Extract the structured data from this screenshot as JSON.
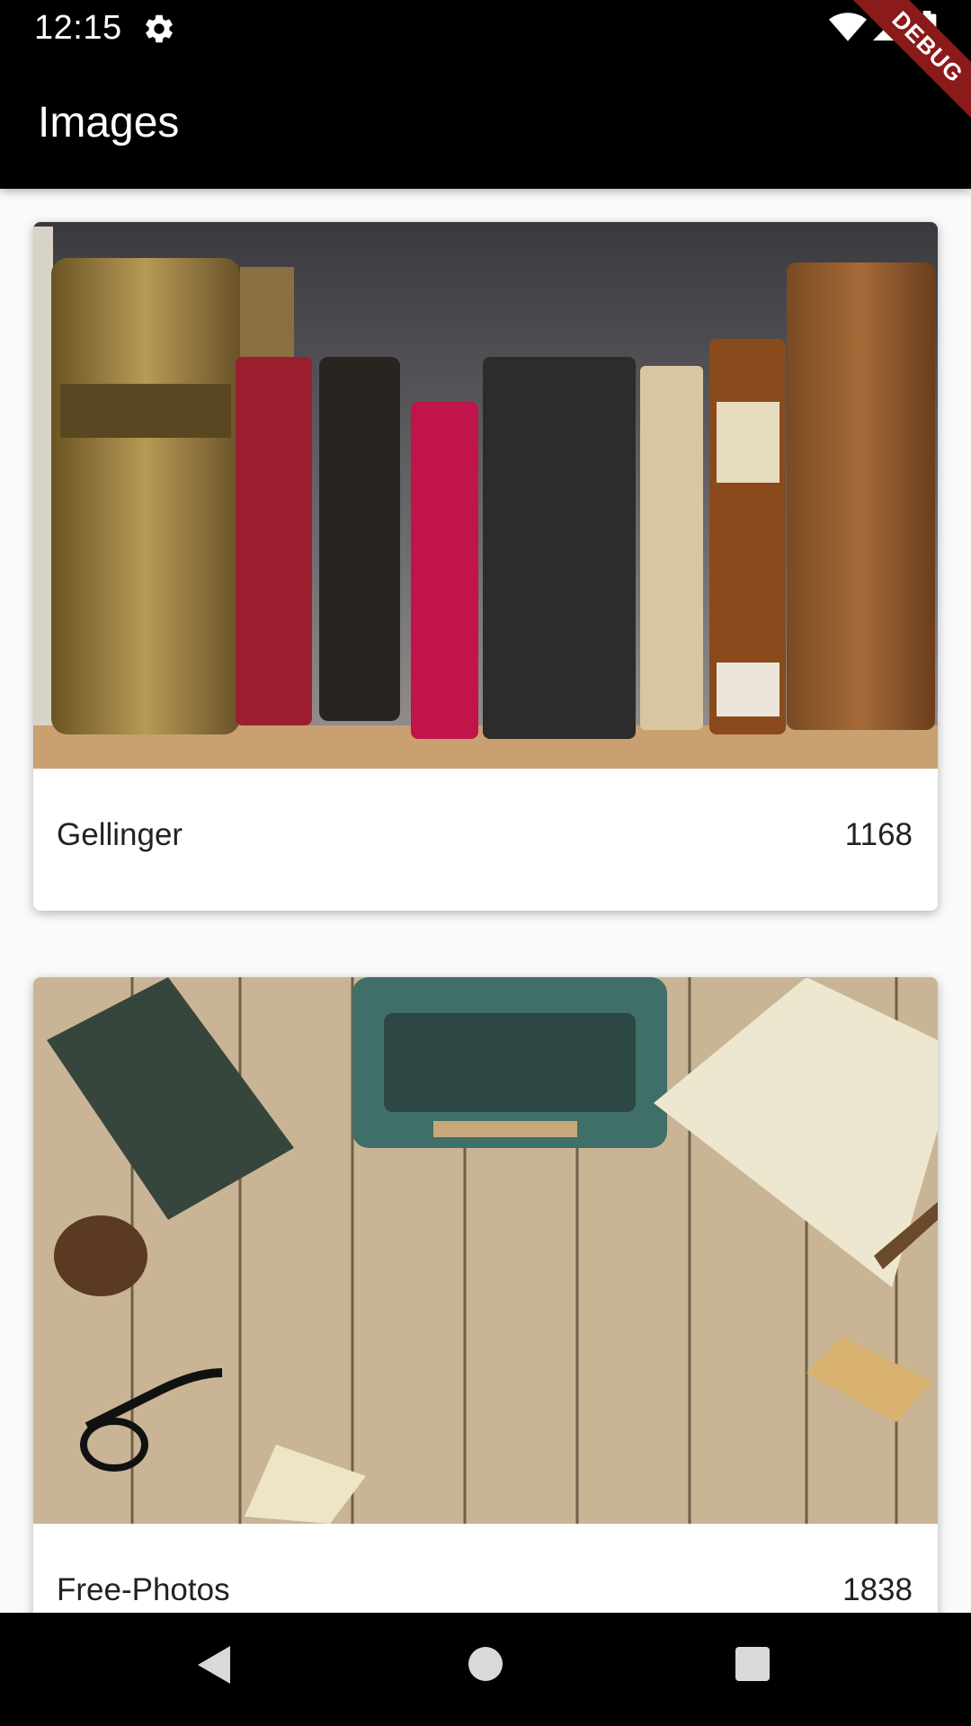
{
  "status_bar": {
    "time": "12:15",
    "icons": [
      "gear-icon",
      "wifi-icon",
      "signal-icon",
      "battery-icon"
    ]
  },
  "debug_banner": {
    "label": "DEBUG",
    "color": "#8b1a1a"
  },
  "app_bar": {
    "title": "Images",
    "background": "#000000"
  },
  "cards": [
    {
      "author": "Gellinger",
      "count": "1168",
      "image": "old books on shelf"
    },
    {
      "author": "Free-Photos",
      "count": "1838",
      "image": "typewriter on wooden desk"
    }
  ],
  "nav_bar": {
    "icons": [
      "back-icon",
      "home-icon",
      "recents-icon"
    ]
  }
}
